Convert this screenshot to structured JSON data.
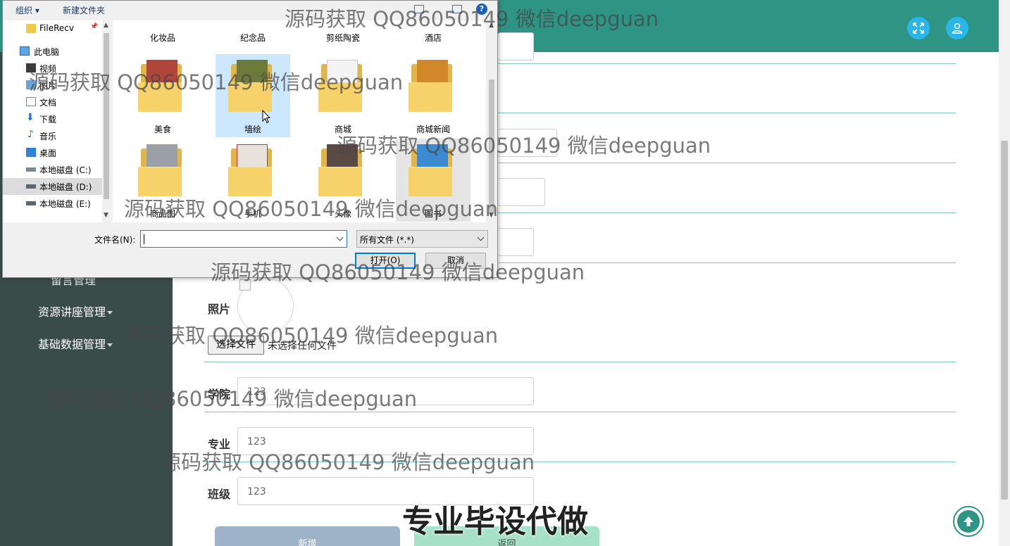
{
  "dialog": {
    "toolbar": {
      "organize": "组织 ▾",
      "new_folder": "新建文件夹",
      "help": "?"
    },
    "nav": [
      {
        "label": "FileRecv",
        "icon": "folder-icon",
        "pinned": "📌"
      },
      {
        "label": "此电脑",
        "icon": "computer-icon"
      },
      {
        "label": "视频",
        "icon": "video-icon"
      },
      {
        "label": "图片",
        "icon": "picture-icon"
      },
      {
        "label": "文档",
        "icon": "document-icon"
      },
      {
        "label": "下载",
        "icon": "download-icon"
      },
      {
        "label": "音乐",
        "icon": "music-icon"
      },
      {
        "label": "桌面",
        "icon": "desktop-icon"
      },
      {
        "label": "本地磁盘 (C:)",
        "icon": "drive-icon"
      },
      {
        "label": "本地磁盘 (D:)",
        "icon": "drive-icon"
      },
      {
        "label": "本地磁盘 (E:)",
        "icon": "drive-icon"
      }
    ],
    "folders": [
      {
        "label": "化妆品"
      },
      {
        "label": "纪念品"
      },
      {
        "label": "剪纸陶瓷"
      },
      {
        "label": "酒店"
      },
      {
        "label": "美食"
      },
      {
        "label": "墙绘"
      },
      {
        "label": "商城"
      },
      {
        "label": "商城新闻"
      },
      {
        "label": "商品图"
      },
      {
        "label": "手机"
      },
      {
        "label": "头像"
      },
      {
        "label": "图书"
      }
    ],
    "filename_label": "文件名(N):",
    "filename_value": "",
    "filetype": "所有文件 (*.*)",
    "open_button": "打开(O)",
    "cancel_button": "取消"
  },
  "sidebar": {
    "items": [
      {
        "label": "留言管理"
      },
      {
        "label": "资源讲座管理"
      },
      {
        "label": "基础数据管理"
      }
    ]
  },
  "form": {
    "photo_label": "照片",
    "file_button": "选择文件",
    "file_status": "未选择任何文件",
    "fields": [
      {
        "label": "学院",
        "value": "123"
      },
      {
        "label": "专业",
        "value": "123"
      },
      {
        "label": "班级",
        "value": "123"
      }
    ],
    "submit_button": "新增",
    "back_button": "返回"
  },
  "watermark": "源码获取 QQ86050149 微信deepguan",
  "stamp": "专业毕设代做",
  "colors": {
    "header": "#2e9484",
    "sidebar": "#3a4c4a",
    "header_button": "#2ab6e8"
  }
}
